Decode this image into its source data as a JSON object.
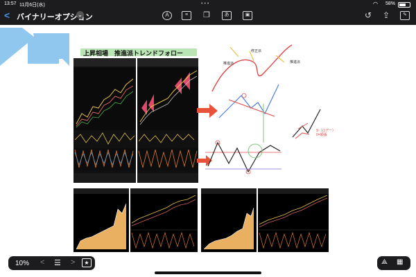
{
  "status_bar": {
    "time": "13:57",
    "date": "11月6日(水)",
    "battery": "58%"
  },
  "toolbar": {
    "back_icon": "chevron-left-icon",
    "title": "バイナリーオプション",
    "center_icons": [
      "pen-icon",
      "text-box-icon",
      "copy-icon",
      "text-recognition-icon",
      "image-icon"
    ],
    "right_icons": [
      "undo-icon",
      "share-icon",
      "edit-icon"
    ]
  },
  "slide": {
    "title": "上昇相場　推進派トレンドフォロー",
    "annotations": {
      "label_1": "推進派",
      "label_2": "修正派",
      "label_3": "推進派",
      "red_note": "S（ロアー）\n0=順張"
    },
    "arrow_color": "#e8523a",
    "pointer_color": "#8fc7ef"
  },
  "bottom_toolbar": {
    "zoom": "10%",
    "icons": [
      "chevron-left-icon",
      "list-icon",
      "chevron-right-icon",
      "bookmark-star-icon"
    ]
  },
  "right_tools": [
    "lasso-icon",
    "grid-icon"
  ]
}
